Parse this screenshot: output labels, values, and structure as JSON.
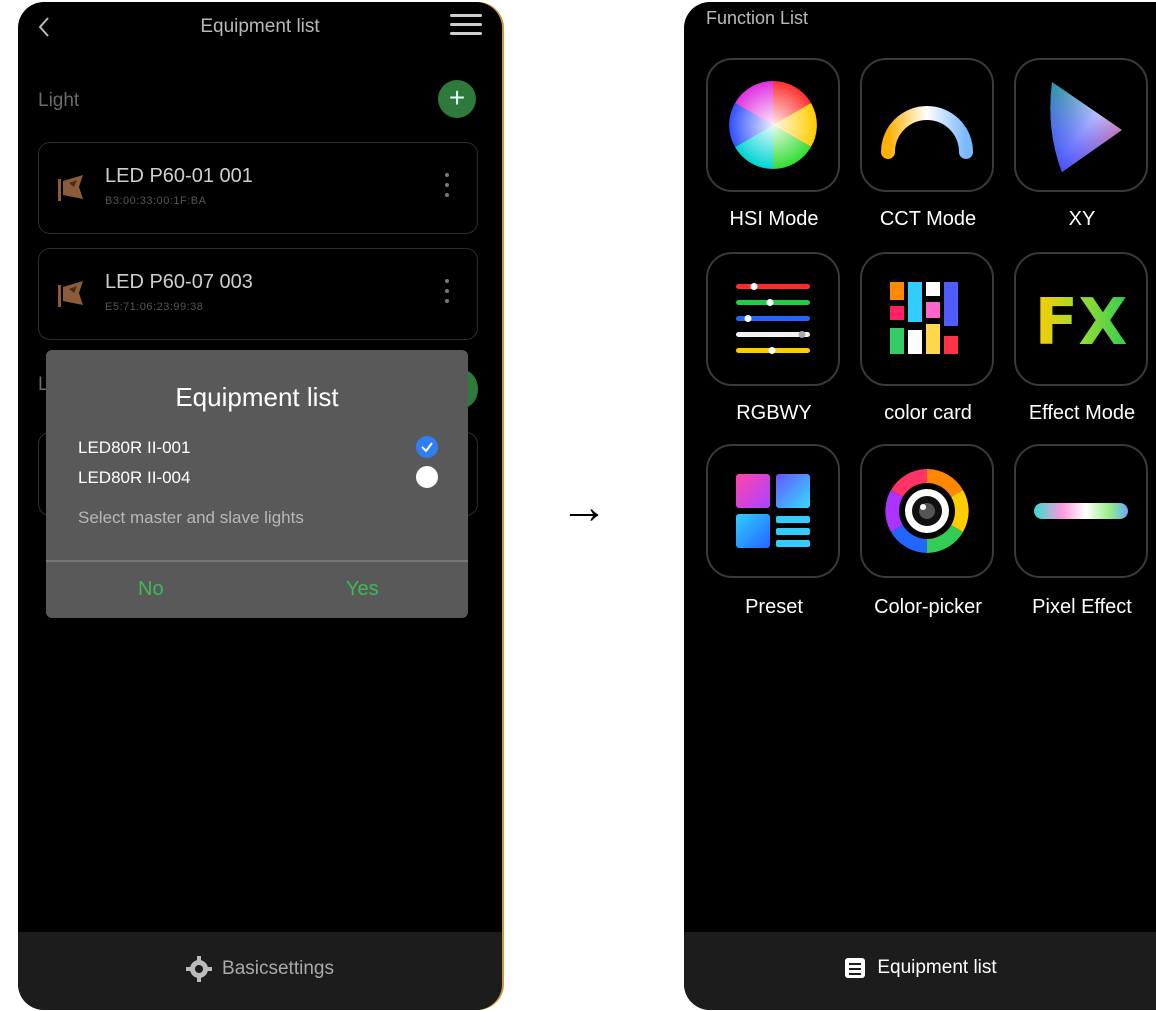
{
  "left_screen": {
    "title": "Equipment list",
    "section_light": "Light",
    "devices": [
      {
        "name": "LED P60-01 001",
        "mac": "B3:00:33:00:1F:BA"
      },
      {
        "name": "LED P60-07 003",
        "mac": "E5:71:06:23:99:38"
      }
    ],
    "dialog": {
      "title": "Equipment list",
      "options": [
        {
          "label": "LED80R II-001",
          "checked": true
        },
        {
          "label": "LED80R II-004",
          "checked": false
        }
      ],
      "hint": "Select master and slave lights",
      "no_label": "No",
      "yes_label": "Yes"
    },
    "bottom_label": "Basicsettings"
  },
  "arrow": "→",
  "right_screen": {
    "title": "Function List",
    "functions": [
      {
        "label": "HSI Mode",
        "icon": "hsi-color-wheel-icon"
      },
      {
        "label": "CCT Mode",
        "icon": "cct-arc-icon"
      },
      {
        "label": "XY",
        "icon": "xy-gamut-icon"
      },
      {
        "label": "RGBWY",
        "icon": "rgbwy-sliders-icon"
      },
      {
        "label": "color card",
        "icon": "color-card-icon"
      },
      {
        "label": "Effect Mode",
        "icon": "fx-icon",
        "icon_text": "FX"
      },
      {
        "label": "Preset",
        "icon": "preset-icon"
      },
      {
        "label": "Color-picker",
        "icon": "color-picker-icon"
      },
      {
        "label": "Pixel Effect",
        "icon": "pixel-effect-icon"
      }
    ],
    "bottom_label": "Equipment list"
  },
  "colors": {
    "accent_green": "#3dba57",
    "check_blue": "#2f7ef5",
    "dialog_bg": "#595959"
  }
}
